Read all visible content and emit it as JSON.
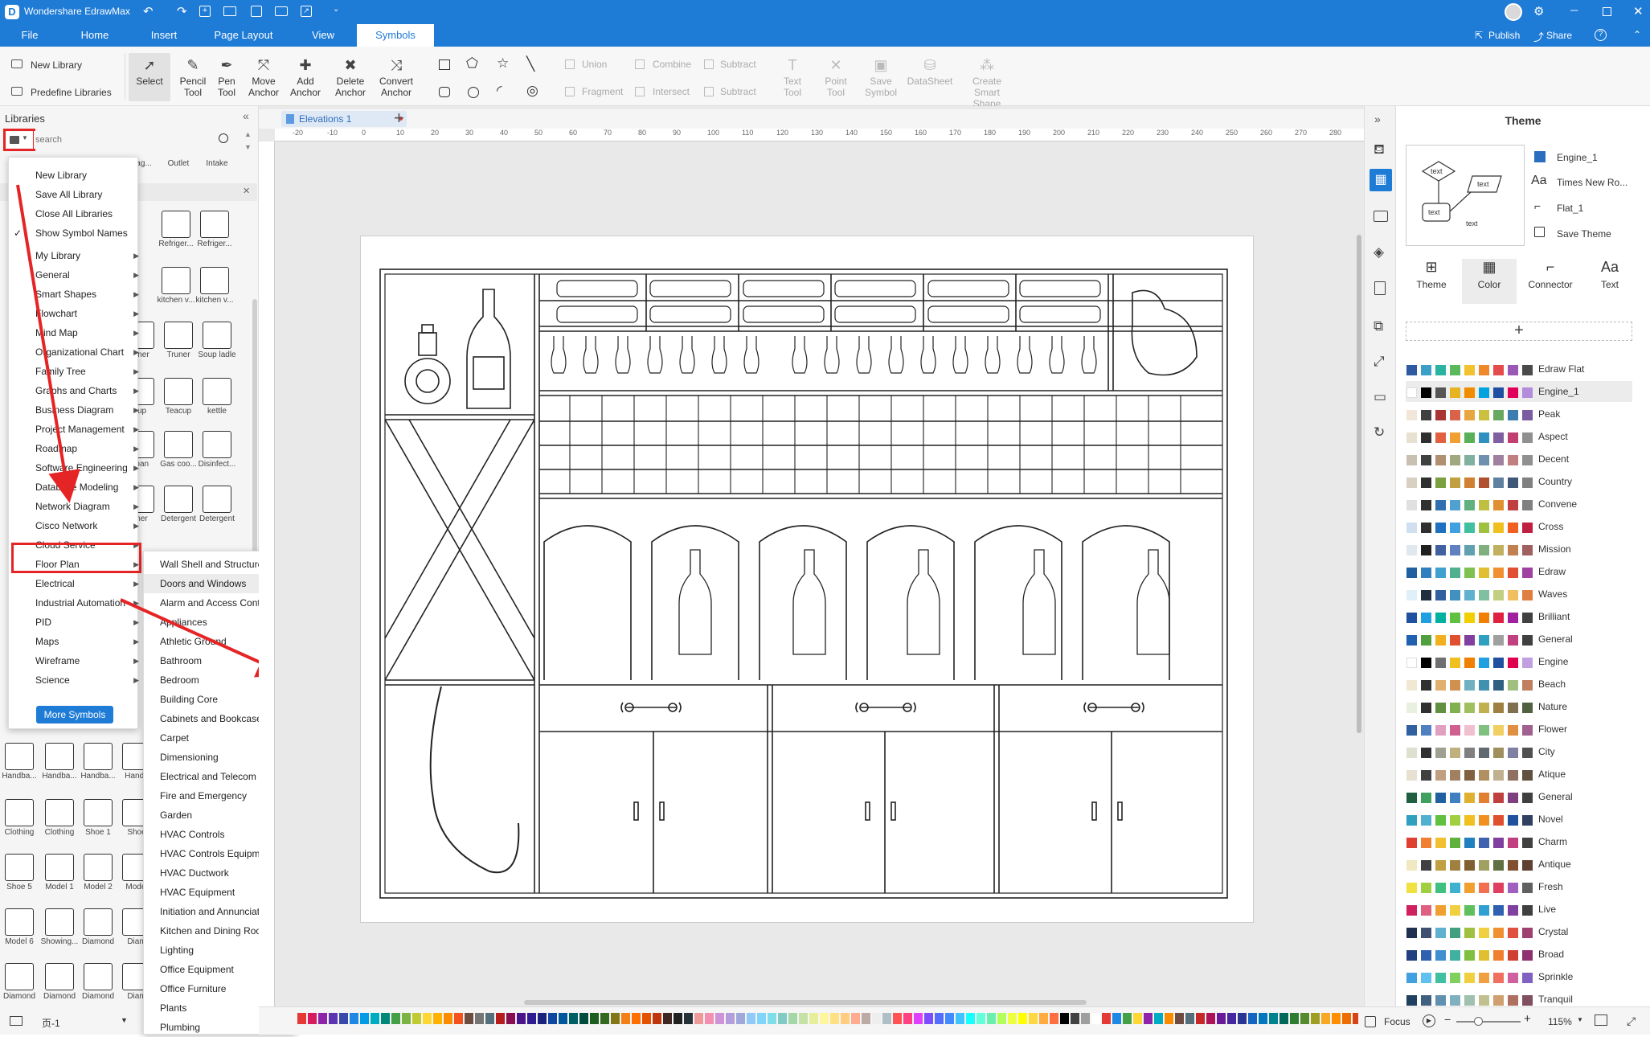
{
  "app": {
    "title": "Wondershare EdrawMax",
    "publish": "Publish",
    "share": "Share"
  },
  "menu": {
    "file": "File",
    "home": "Home",
    "insert": "Insert",
    "page_layout": "Page Layout",
    "view": "View",
    "symbols": "Symbols"
  },
  "ribbon": {
    "new_library": "New Library",
    "predefine_libraries": "Predefine Libraries",
    "select": "Select",
    "pencil_tool": "Pencil Tool",
    "pen_tool": "Pen Tool",
    "move_anchor": "Move Anchor",
    "add_anchor": "Add Anchor",
    "delete_anchor": "Delete Anchor",
    "convert_anchor": "Convert Anchor",
    "union": "Union",
    "combine": "Combine",
    "subtract": "Subtract",
    "fragment": "Fragment",
    "intersect": "Intersect",
    "subtract2": "Subtract",
    "text_tool": "Text Tool",
    "point_tool": "Point Tool",
    "save_symbol": "Save Symbol",
    "datasheet": "DataSheet",
    "create_smart_shape": "Create Smart Shape"
  },
  "libraries": {
    "title": "Libraries",
    "search_placeholder": "search",
    "more_symbols": "More Symbols",
    "page_name": "页-1"
  },
  "dropdown": [
    "New Library",
    "Save All Library",
    "Close All Libraries",
    "Show Symbol Names",
    "My Library",
    "General",
    "Smart Shapes",
    "Flowchart",
    "Mind Map",
    "Organizational Chart",
    "Family Tree",
    "Graphs and Charts",
    "Business Diagram",
    "Project Management",
    "Roadmap",
    "Software Engineering",
    "Database Modeling",
    "Network Diagram",
    "Cisco Network",
    "Cloud Service",
    "Floor Plan",
    "Electrical",
    "Industrial Automation",
    "PID",
    "Maps",
    "Wireframe",
    "Science"
  ],
  "submenu": [
    "Wall Shell and Structure",
    "Doors and Windows",
    "Alarm and Access Control",
    "Appliances",
    "Athletic Ground",
    "Bathroom",
    "Bedroom",
    "Building Core",
    "Cabinets and Bookcases",
    "Carpet",
    "Dimensioning",
    "Electrical and Telecom",
    "Fire and Emergency",
    "Garden",
    "HVAC Controls",
    "HVAC Controls Equipment",
    "HVAC Ductwork",
    "HVAC Equipment",
    "Initiation and Annunciation",
    "Kitchen and Dining Room",
    "Lighting",
    "Office Equipment",
    "Office Furniture",
    "Plants",
    "Plumbing"
  ],
  "lib_labels": {
    "row0": [
      "ag...",
      "Outlet",
      "Intake"
    ],
    "row1": [
      "Refriger...",
      "Refriger..."
    ],
    "row2": [
      "kitchen v...",
      "kitchen v..."
    ],
    "row3": [
      "runer",
      "Truner",
      "Soup ladle"
    ],
    "row4": [
      "cup",
      "Teacup",
      "kettle"
    ],
    "row5": [
      "epan",
      "Gas coo...",
      "Disinfect..."
    ],
    "row6": [
      "sher",
      "Detergent",
      "Detergent"
    ],
    "row7": [
      "Handba...",
      "Handba...",
      "Handba...",
      "Handb"
    ],
    "row8": [
      "Clothing",
      "Clothing",
      "Shoe 1",
      "Shoe"
    ],
    "row9": [
      "Shoe 5",
      "Model 1",
      "Model 2",
      "Model"
    ],
    "row10": [
      "Model 6",
      "Showing...",
      "Diamond",
      "Diam"
    ],
    "row11": [
      "Diamond",
      "Diamond",
      "Diamond",
      "Diam"
    ]
  },
  "tab": {
    "name": "Elevations 1"
  },
  "ruler": [
    "-20",
    "-10",
    "0",
    "10",
    "20",
    "30",
    "40",
    "50",
    "60",
    "70",
    "80",
    "90",
    "100",
    "110",
    "120",
    "130",
    "140",
    "150",
    "160",
    "170",
    "180",
    "190",
    "200",
    "210",
    "220",
    "230",
    "240",
    "250",
    "260",
    "270",
    "280"
  ],
  "right": {
    "title": "Theme",
    "engine": "Engine_1",
    "font": "Times New Ro...",
    "connector_style": "Flat_1",
    "save_theme": "Save Theme",
    "tabs": [
      "Theme",
      "Color",
      "Connector",
      "Text"
    ]
  },
  "themes": [
    {
      "name": "Edraw Flat",
      "colors": [
        "#2d5aa0",
        "#3aa0c8",
        "#2ab3a0",
        "#5bb85c",
        "#f2c12e",
        "#f0882a",
        "#e54b4b",
        "#9b59b6",
        "#4a4a4a"
      ]
    },
    {
      "name": "Engine_1",
      "colors": [
        "#ffffff",
        "#000000",
        "#555555",
        "#e6b422",
        "#f08c00",
        "#00a3e0",
        "#1f4fa0",
        "#e0005a",
        "#b48cdc"
      ]
    },
    {
      "name": "Peak",
      "colors": [
        "#f2e6d8",
        "#404040",
        "#aa3333",
        "#d9634a",
        "#e8a640",
        "#ccc040",
        "#68a860",
        "#3c7cb0",
        "#7c5ca0"
      ]
    },
    {
      "name": "Aspect",
      "colors": [
        "#e8e0d0",
        "#303030",
        "#e06040",
        "#f0a030",
        "#58b058",
        "#3090c0",
        "#8060a0",
        "#c04070",
        "#909090"
      ]
    },
    {
      "name": "Decent",
      "colors": [
        "#c8c0b0",
        "#404040",
        "#b09070",
        "#a0a880",
        "#80b0a0",
        "#7090b0",
        "#a080a0",
        "#c08080",
        "#909090"
      ]
    },
    {
      "name": "Country",
      "colors": [
        "#d8d0c0",
        "#303030",
        "#7aa040",
        "#c0a040",
        "#d08030",
        "#b05030",
        "#6080a0",
        "#405878",
        "#808080"
      ]
    },
    {
      "name": "Convene",
      "colors": [
        "#e0e0e0",
        "#303030",
        "#3070b0",
        "#50a0d0",
        "#60b080",
        "#c0c040",
        "#e09030",
        "#c04040",
        "#808080"
      ]
    },
    {
      "name": "Cross",
      "colors": [
        "#d0e0f0",
        "#303030",
        "#2070c0",
        "#40a0e0",
        "#40c0a0",
        "#a0c040",
        "#f0c020",
        "#f06020",
        "#c02040"
      ]
    },
    {
      "name": "Mission",
      "colors": [
        "#e0e8f0",
        "#202020",
        "#4060a0",
        "#6080c0",
        "#60a0b0",
        "#80b080",
        "#c0b060",
        "#c08050",
        "#a06060"
      ]
    },
    {
      "name": "Edraw",
      "colors": [
        "#2060a0",
        "#3080c0",
        "#40a0d0",
        "#50b090",
        "#80c050",
        "#e0c030",
        "#f09030",
        "#e05030",
        "#a040a0"
      ]
    },
    {
      "name": "Waves",
      "colors": [
        "#e0f0f8",
        "#203040",
        "#3060a0",
        "#4090c0",
        "#60b0d0",
        "#80c0a0",
        "#c0d080",
        "#f0c060",
        "#e08040"
      ]
    },
    {
      "name": "Brilliant",
      "colors": [
        "#2050a0",
        "#20a0e0",
        "#00b0a0",
        "#60c040",
        "#f0d000",
        "#f08000",
        "#e02040",
        "#a020a0",
        "#404040"
      ]
    },
    {
      "name": "General",
      "colors": [
        "#2060b0",
        "#50a040",
        "#f0b020",
        "#e05030",
        "#8040a0",
        "#30a0c0",
        "#a0a0a0",
        "#c04080",
        "#404040"
      ]
    },
    {
      "name": "Engine",
      "colors": [
        "#ffffff",
        "#000000",
        "#707070",
        "#f0c020",
        "#f08000",
        "#20a0e0",
        "#2050a0",
        "#e00050",
        "#c0a0e0"
      ]
    },
    {
      "name": "Beach",
      "colors": [
        "#f0e8d0",
        "#303030",
        "#e0b070",
        "#d09050",
        "#70b0c0",
        "#4090b0",
        "#306080",
        "#a0c080",
        "#c08060"
      ]
    },
    {
      "name": "Nature",
      "colors": [
        "#e8f0e0",
        "#303030",
        "#609040",
        "#80b050",
        "#a0c060",
        "#c0b050",
        "#a08040",
        "#807050",
        "#506040"
      ]
    },
    {
      "name": "Flower",
      "colors": [
        "#3060a0",
        "#5080c0",
        "#e0a0c0",
        "#d06090",
        "#f0c0d0",
        "#80c080",
        "#f0d060",
        "#e09040",
        "#a06090"
      ]
    },
    {
      "name": "City",
      "colors": [
        "#e0e0d0",
        "#303030",
        "#a0a090",
        "#c0b080",
        "#808080",
        "#606870",
        "#a09060",
        "#8080a0",
        "#505050"
      ]
    },
    {
      "name": "Atique",
      "colors": [
        "#e8e0d0",
        "#404040",
        "#c0a080",
        "#a08060",
        "#806040",
        "#b09060",
        "#c0b090",
        "#907060",
        "#605040"
      ]
    },
    {
      "name": "General",
      "colors": [
        "#206040",
        "#40a060",
        "#2060a0",
        "#4080c0",
        "#e0b030",
        "#e08030",
        "#c04040",
        "#804080",
        "#404040"
      ]
    },
    {
      "name": "Novel",
      "colors": [
        "#30a0c0",
        "#50b0d0",
        "#60c040",
        "#a0d040",
        "#f0c020",
        "#f09020",
        "#e05030",
        "#2050a0",
        "#304060"
      ]
    },
    {
      "name": "Charm",
      "colors": [
        "#e04030",
        "#f08030",
        "#f0c030",
        "#60b040",
        "#2080c0",
        "#4060b0",
        "#8040a0",
        "#c04080",
        "#404040"
      ]
    },
    {
      "name": "Antique",
      "colors": [
        "#f0e8c0",
        "#404040",
        "#c0a040",
        "#a08040",
        "#806030",
        "#a0a060",
        "#607040",
        "#805030",
        "#604030"
      ]
    },
    {
      "name": "Fresh",
      "colors": [
        "#f0e040",
        "#a0d040",
        "#40c080",
        "#40b0d0",
        "#f0a030",
        "#f07050",
        "#e04060",
        "#a060c0",
        "#606060"
      ]
    },
    {
      "name": "Live",
      "colors": [
        "#d02060",
        "#e06080",
        "#f0a030",
        "#f0d040",
        "#60c060",
        "#30a0d0",
        "#3060b0",
        "#8040a0",
        "#404040"
      ]
    },
    {
      "name": "Crystal",
      "colors": [
        "#203050",
        "#405070",
        "#60b0d0",
        "#40a080",
        "#a0c040",
        "#f0d040",
        "#f09030",
        "#e05040",
        "#a04070"
      ]
    },
    {
      "name": "Broad",
      "colors": [
        "#204080",
        "#3060b0",
        "#4090d0",
        "#40b0a0",
        "#80c040",
        "#e0c030",
        "#f08030",
        "#d04030",
        "#903070"
      ]
    },
    {
      "name": "Sprinkle",
      "colors": [
        "#40a0e0",
        "#60c0f0",
        "#40c0a0",
        "#80d060",
        "#f0d040",
        "#f0a040",
        "#f07060",
        "#d060a0",
        "#8060c0"
      ]
    },
    {
      "name": "Tranquil",
      "colors": [
        "#204060",
        "#406080",
        "#6090b0",
        "#80b0c0",
        "#a0c0b0",
        "#c0c090",
        "#d0a070",
        "#b07060",
        "#805060"
      ]
    }
  ],
  "bottom": {
    "focus": "Focus",
    "zoom": "115%"
  },
  "palette": [
    "#e53935",
    "#d81b60",
    "#8e24aa",
    "#5e35b1",
    "#3949ab",
    "#1e88e5",
    "#039be5",
    "#00acc1",
    "#00897b",
    "#43a047",
    "#7cb342",
    "#c0ca33",
    "#fdd835",
    "#ffb300",
    "#fb8c00",
    "#f4511e",
    "#6d4c41",
    "#757575",
    "#546e7a",
    "#b71c1c",
    "#880e4f",
    "#4a148c",
    "#311b92",
    "#1a237e",
    "#0d47a1",
    "#01579b",
    "#006064",
    "#004d40",
    "#1b5e20",
    "#33691e",
    "#827717",
    "#f57f17",
    "#ff6f00",
    "#e65100",
    "#bf360c",
    "#3e2723",
    "#212121",
    "#263238",
    "#ef9a9a",
    "#f48fb1",
    "#ce93d8",
    "#b39ddb",
    "#9fa8da",
    "#90caf9",
    "#81d4fa",
    "#80deea",
    "#80cbc4",
    "#a5d6a7",
    "#c5e1a5",
    "#e6ee9c",
    "#fff59d",
    "#ffe082",
    "#ffcc80",
    "#ffab91",
    "#bcaaa4",
    "#eeeeee",
    "#b0bec5",
    "#ff5252",
    "#ff4081",
    "#e040fb",
    "#7c4dff",
    "#536dfe",
    "#448aff",
    "#40c4ff",
    "#18ffff",
    "#64ffda",
    "#69f0ae",
    "#b2ff59",
    "#eeff41",
    "#ffff00",
    "#ffd740",
    "#ffab40",
    "#ff6e40",
    "#000000",
    "#424242",
    "#9e9e9e",
    "#ffffff",
    "#e53935",
    "#1e88e5",
    "#43a047",
    "#fdd835",
    "#8e24aa",
    "#00acc1",
    "#fb8c00",
    "#6d4c41",
    "#546e7a",
    "#c62828",
    "#ad1457",
    "#6a1b9a",
    "#4527a0",
    "#283593",
    "#1565c0",
    "#0277bd",
    "#00838f",
    "#00695c",
    "#2e7d32",
    "#558b2f",
    "#9e9d24",
    "#f9a825",
    "#ff8f00",
    "#ef6c00",
    "#d84315",
    "#4e342e",
    "#37474f",
    "#ff1744",
    "#f50057",
    "#d500f9",
    "#651fff",
    "#3d5afe",
    "#2979ff",
    "#00b0ff",
    "#00e5ff",
    "#1de9b6",
    "#00e676",
    "#76ff03",
    "#c6ff00",
    "#ffea00",
    "#ffc400",
    "#ff9100",
    "#ff3d00",
    "#333333",
    "#666666",
    "#999999",
    "#cccccc"
  ]
}
